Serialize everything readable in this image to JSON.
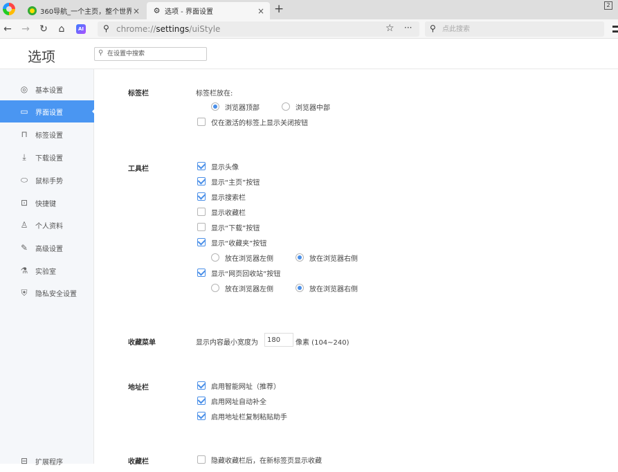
{
  "window": {
    "badge": "2"
  },
  "tabs": [
    {
      "label": "360导航_一个主页，整个世界",
      "close": "×",
      "icon": "360-icon"
    },
    {
      "label": "选项 - 界面设置",
      "close": "×",
      "icon": "gear-icon"
    }
  ],
  "newtab": "+",
  "toolbar": {
    "url_scheme": "chrome://",
    "url_host": "settings",
    "url_path": "/uiStyle",
    "search_placeholder": "点此搜索",
    "ai_label": "AI",
    "more": "···"
  },
  "page": {
    "title": "选项",
    "search_placeholder": "在设置中搜索"
  },
  "sidebar": {
    "items": [
      {
        "label": "基本设置",
        "icon": "basic-settings-icon"
      },
      {
        "label": "界面设置",
        "icon": "ui-settings-icon"
      },
      {
        "label": "标签设置",
        "icon": "tab-settings-icon"
      },
      {
        "label": "下载设置",
        "icon": "download-icon"
      },
      {
        "label": "鼠标手势",
        "icon": "mouse-icon"
      },
      {
        "label": "快捷键",
        "icon": "keyboard-icon"
      },
      {
        "label": "个人资料",
        "icon": "person-icon"
      },
      {
        "label": "高级设置",
        "icon": "advanced-icon"
      },
      {
        "label": "实验室",
        "icon": "lab-icon"
      },
      {
        "label": "隐私安全设置",
        "icon": "shield-icon"
      }
    ],
    "active_index": 1,
    "bottom_item": {
      "label": "扩展程序",
      "icon": "extensions-icon"
    }
  },
  "sections": {
    "tabbar": {
      "title": "标签栏",
      "position_label": "标签栏放在:",
      "position_options": [
        {
          "label": "浏览器顶部",
          "checked": true
        },
        {
          "label": "浏览器中部",
          "checked": false
        }
      ],
      "close_on_active": {
        "label": "仅在激活的标签上显示关闭按钮",
        "checked": false
      }
    },
    "toolbar": {
      "title": "工具栏",
      "items": [
        {
          "label": "显示头像",
          "checked": true
        },
        {
          "label": "显示“主页”按钮",
          "checked": true
        },
        {
          "label": "显示搜索栏",
          "checked": true
        },
        {
          "label": "显示收藏栏",
          "checked": false
        },
        {
          "label": "显示“下载”按钮",
          "checked": false
        },
        {
          "label": "显示“收藏夹”按钮",
          "checked": true
        },
        {
          "label": "显示“网页回收站”按钮",
          "checked": true
        }
      ],
      "favorites_side": [
        {
          "label": "放在浏览器左侧",
          "checked": false
        },
        {
          "label": "放在浏览器右侧",
          "checked": true
        }
      ],
      "recycle_side": [
        {
          "label": "放在浏览器左侧",
          "checked": false
        },
        {
          "label": "放在浏览器右侧",
          "checked": true
        }
      ]
    },
    "favmenu": {
      "title": "收藏菜单",
      "prefix": "显示内容最小宽度为",
      "value": "180",
      "suffix": "像素 (104~240)"
    },
    "addressbar": {
      "title": "地址栏",
      "items": [
        {
          "label": "启用智能网址（推荐）",
          "checked": true
        },
        {
          "label": "启用网址自动补全",
          "checked": true
        },
        {
          "label": "启用地址栏复制粘贴助手",
          "checked": true
        }
      ]
    },
    "favbar": {
      "title": "收藏栏",
      "hide_option": {
        "label": "隐藏收藏栏后，在新标签页显示收藏",
        "checked": false
      }
    }
  }
}
